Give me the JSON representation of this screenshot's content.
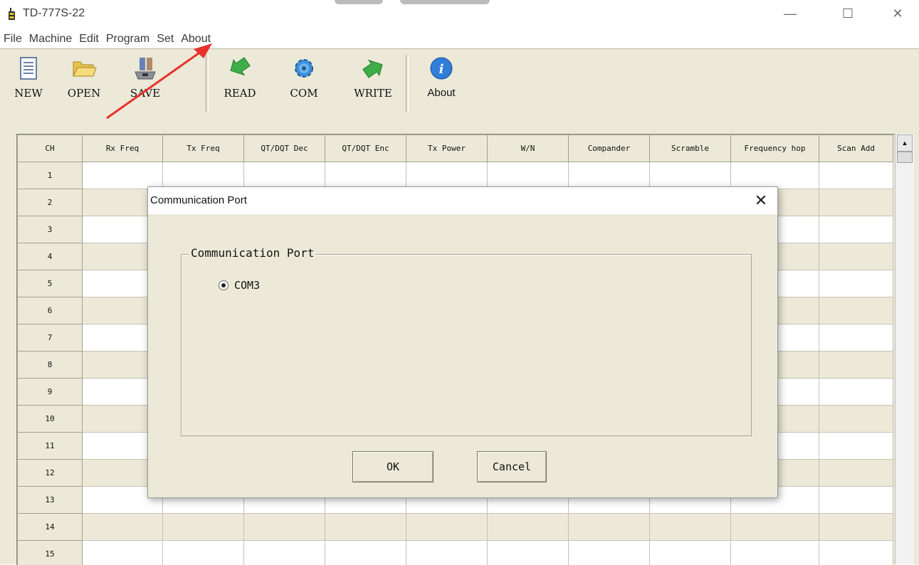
{
  "window": {
    "title": "TD-777S-22",
    "minimize": "—",
    "maximize": "☐",
    "close": "✕"
  },
  "menu": [
    "File",
    "Machine",
    "Edit",
    "Program",
    "Set",
    "About"
  ],
  "toolbar": {
    "new": "NEW",
    "open": "OPEN",
    "save": "SAVE",
    "read": "READ",
    "com": "COM",
    "write": "WRITE",
    "about": "About"
  },
  "grid": {
    "headers": [
      "CH",
      "Rx Freq",
      "Tx Freq",
      "QT/DQT Dec",
      "QT/DQT Enc",
      "Tx Power",
      "W/N",
      "Compander",
      "Scramble",
      "Frequency hop",
      "Scan Add"
    ],
    "rows": [
      "1",
      "2",
      "3",
      "4",
      "5",
      "6",
      "7",
      "8",
      "9",
      "10",
      "11",
      "12",
      "13",
      "14",
      "15"
    ]
  },
  "dialog": {
    "title": "Communication Port",
    "close": "✕",
    "group_label": "Communication Port",
    "port_option": "COM3",
    "port_selected": true,
    "ok": "OK",
    "cancel": "Cancel"
  },
  "colors": {
    "panel": "#ece9d8",
    "annotation_arrow": "#e8322c"
  }
}
